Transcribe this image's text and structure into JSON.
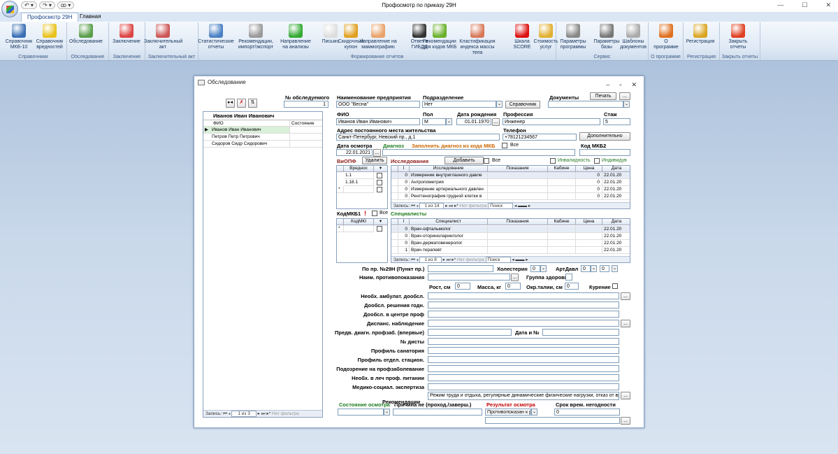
{
  "window": {
    "title": "Профосмотр по приказу 29Н",
    "min": "—",
    "max": "☐",
    "close": "✕"
  },
  "qat": [
    "↶ ▾",
    "↷ ▾",
    "ꝏ ▾"
  ],
  "tabs": [
    "Профосмотр 29Н",
    "Главная"
  ],
  "ribbon": {
    "groups": [
      "Справочники",
      "Обследование",
      "Заключение",
      "Заключительный акт",
      "Формирование отчетов",
      "Сервис",
      "О программе",
      "Регистрация",
      "Закрыть отчеты"
    ],
    "buttons": [
      {
        "l1": "Справочник",
        "l2": "МКБ-10",
        "icon": "book-icon",
        "color": "#3a6fb5"
      },
      {
        "l1": "Справочник",
        "l2": "вредностей",
        "icon": "radiation-icon",
        "color": "#e8c21a"
      },
      {
        "l1": "Обследование",
        "l2": "",
        "icon": "people-icon",
        "color": "#5a9e4a"
      },
      {
        "l1": "Заключение",
        "l2": "",
        "icon": "medical-doc-icon",
        "color": "#d44"
      },
      {
        "l1": "Заключительный",
        "l2": "акт",
        "icon": "pen-doc-icon",
        "color": "#c55"
      },
      {
        "l1": "Статистические",
        "l2": "отчеты",
        "icon": "chart-icon",
        "color": "#4a80c4"
      },
      {
        "l1": "Рекомендации,",
        "l2": "импорт/экспорт",
        "icon": "database-icon",
        "color": "#999"
      },
      {
        "l1": "Направление",
        "l2": "на анализы",
        "icon": "syringe-icon",
        "color": "#3a3"
      },
      {
        "l1": "Письмо",
        "l2": "",
        "icon": "envelope-icon",
        "color": "#ddd"
      },
      {
        "l1": "Скидочный",
        "l2": "купон",
        "icon": "coin-icon",
        "color": "#e0a020"
      },
      {
        "l1": "Направление на",
        "l2": "маммографию",
        "icon": "woman-icon",
        "color": "#e9a26a"
      },
      {
        "l1": "Ответ в",
        "l2": "ГИБДД",
        "icon": "traffic-light-icon",
        "color": "#333"
      },
      {
        "l1": "Рекомендации",
        "l2": "для кодов МКБ",
        "icon": "apple-icon",
        "color": "#6ab02c"
      },
      {
        "l1": "Кластификация",
        "l2": "индекса массы тела",
        "icon": "scale-person-icon",
        "color": "#d8795a"
      },
      {
        "l1": "Шкала",
        "l2": "SCORE",
        "icon": "heart-icon",
        "color": "#d11"
      },
      {
        "l1": "Стоимость",
        "l2": "услуг",
        "icon": "coins-icon",
        "color": "#e0b030"
      },
      {
        "l1": "Параметры",
        "l2": "программы",
        "icon": "tools-icon",
        "color": "#888"
      },
      {
        "l1": "Параметры",
        "l2": "базы",
        "icon": "gear-icon",
        "color": "#777"
      },
      {
        "l1": "Шаблоны",
        "l2": "документов",
        "icon": "documents-icon",
        "color": "#aaa"
      },
      {
        "l1": "О",
        "l2": "программе",
        "icon": "clock-icon",
        "color": "#e07020"
      },
      {
        "l1": "Регистрация",
        "l2": "",
        "icon": "key-icon",
        "color": "#d9a520"
      },
      {
        "l1": "Закрыть",
        "l2": "отчеты",
        "icon": "close-circle-icon",
        "color": "#e04020"
      }
    ]
  },
  "dialog": {
    "title": "Обследование",
    "exam_no_label": "№ обследуемого",
    "exam_no": "1",
    "company_label": "Наименование предприятия",
    "company": "ООО \"Весна\"",
    "division_label": "Подразделение",
    "division": "Нет",
    "directory_btn": "Справочник",
    "documents_label": "Документы",
    "print_btn": "Печать",
    "ellipsis": "...",
    "list_header": "Иванов Иван Иванович",
    "list_cols": [
      "ФИО",
      "Состояние"
    ],
    "list_rows": [
      "Иванов Иван Иванович",
      "Петров Петр Петрович",
      "Сидоров Сидр Сидорович"
    ],
    "list_nav": {
      "label": "Запись:",
      "pos": "1 из 3",
      "filter": "Нет фильтра"
    },
    "fio_label": "ФИО",
    "fio": "Иванов Иван Иванович",
    "sex_label": "Пол",
    "sex": "М",
    "dob_label": "Дата рождения",
    "dob": "01.01.1970",
    "prof_label": "Профессия",
    "prof": "Инженер",
    "stazh_label": "Стаж",
    "stazh": "5",
    "addr_label": "Адрес постоянного места жительства",
    "addr": "Санкт-Петербург, Невский пр., д.1",
    "phone_label": "Телефон",
    "phone": "+78121234567",
    "more_btn": "Дополнительно",
    "date_label": "Дата осмотра",
    "date": "22.01.2021",
    "diag_label": "Диагноз",
    "fill_label": "Заполнить диагноз из кода МКБ",
    "all_label": "Все",
    "mkb2_label": "Код МКБ2",
    "vpf_label": "ВиОПФ",
    "delete_btn": "Удалить",
    "vpf_col": "Вреднос",
    "vpf_rows": [
      "1.1",
      "1.18.1"
    ],
    "research_label": "Исследования",
    "add_btn": "Добавить",
    "invalid_label": "Инвалидность",
    "indiv_label": "Индивидув",
    "research_cols": [
      "I",
      "Исследование",
      "Показания",
      "Кабине",
      "Цена",
      "Дата"
    ],
    "research_rows": [
      {
        "i": "0",
        "name": "Измерение внутриглазного давле",
        "price": "0",
        "date": "22.01.20"
      },
      {
        "i": "0",
        "name": "Антропометрия",
        "price": "0",
        "date": "22.01.20"
      },
      {
        "i": "0",
        "name": "Измерение артериального давлен",
        "price": "0",
        "date": "22.01.20"
      },
      {
        "i": "0",
        "name": "Рентгенография грудной клетки в",
        "price": "0",
        "date": "22.01.20"
      }
    ],
    "research_nav": {
      "label": "Запись:",
      "pos": "1 из 14",
      "filter": "Нет фильтра",
      "search": "Поиск"
    },
    "mkb1_label": "КодМКБ1",
    "mkb1_col": "КодМКІ",
    "spec_label": "Специалисты",
    "spec_cols": [
      "I",
      "Специалист",
      "Показания",
      "Кабине",
      "Цена",
      "Дата"
    ],
    "spec_rows": [
      {
        "i": "0",
        "name": "Врач-офтальмолог",
        "date": "22.01.20"
      },
      {
        "i": "0",
        "name": "Врач-оториноларинголог",
        "date": "22.01.20"
      },
      {
        "i": "0",
        "name": "Врач-дерматовенеролог",
        "date": "22.01.20"
      },
      {
        "i": "1",
        "name": "Врач-терапевт",
        "date": "22.01.20"
      }
    ],
    "spec_nav": {
      "label": "Запись:",
      "pos": "1 из 8",
      "filter": "Нет фильтра",
      "search": "Поиск"
    },
    "pr29_label": "По пр. №29Н (Пункт пр.)",
    "chol_label": "Холестерин",
    "chol": "0",
    "art_label": "АртДавл",
    "art1": "0",
    "art2": "0",
    "contra_label": "Наим. противопоказания",
    "health_label": "Группа здоровья",
    "height_label": "Рост, см",
    "height": "0",
    "weight_label": "Масса, кг",
    "weight": "0",
    "waist_label": "Окр.талии, см",
    "waist": "0",
    "smoke_label": "Курение",
    "f1": "Необх. амбулат. дообсл.",
    "f2": "Дообсл. решения годн.",
    "f3": "Дообсл. в центре проф",
    "f4": "Диспанс. наблюдение",
    "f5": "Предв. диагн. профзаб. (впервые)",
    "f5b": "Дата и №",
    "f6": "№ дисты",
    "f7": "Профиль санатория",
    "f8": "Профиль отдел. стацион.",
    "f9": "Подозрение на профзаболевание",
    "f10": "Необх. в леч проф. питании",
    "f11": "Медико-социал. экспертиза",
    "rec_label": "Рекомендации",
    "rec": "Режим труда и отдыха, регулярные динамические физические нагрузки, отказ от вр",
    "state_label": "Состояние осмотра",
    "reason_label": "Причина не (проход./заверш.)",
    "result_label": "Результат осмотра",
    "result": "Противопоказан к раб",
    "sick_label": "Срок врем. негодности",
    "sick": "0"
  }
}
